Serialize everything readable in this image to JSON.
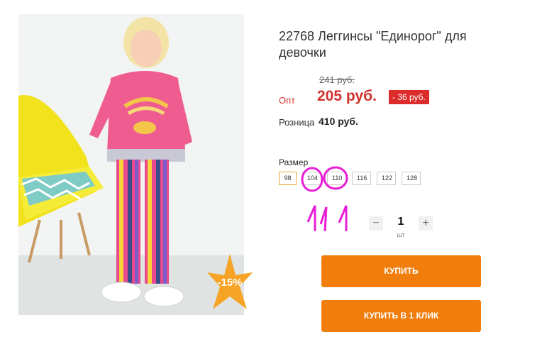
{
  "product": {
    "title": "22768 Леггинсы \"Единорог\" для девочки",
    "old_price": "241 руб.",
    "opt_label": "Опт",
    "opt_price": "205 руб.",
    "save_badge": "- 36 руб.",
    "retail_label": "Розница",
    "retail_price": "410 руб.",
    "discount_badge": "-15%"
  },
  "sizes": {
    "label": "Размер",
    "options": [
      "98",
      "104",
      "110",
      "116",
      "122",
      "128"
    ],
    "selected": "98"
  },
  "quantity": {
    "minus": "−",
    "value": "1",
    "unit": "шт",
    "plus": "+"
  },
  "buttons": {
    "buy": "КУПИТЬ",
    "one_click": "КУПИТЬ В 1 КЛИК"
  },
  "annotation": {
    "handwritten_marks": "11",
    "color": "#e81ed6"
  },
  "colors": {
    "accent_orange": "#f07d0c",
    "price_red": "#d0312d",
    "badge_red": "#dc2b2b",
    "selected_border": "#e8a93a"
  }
}
